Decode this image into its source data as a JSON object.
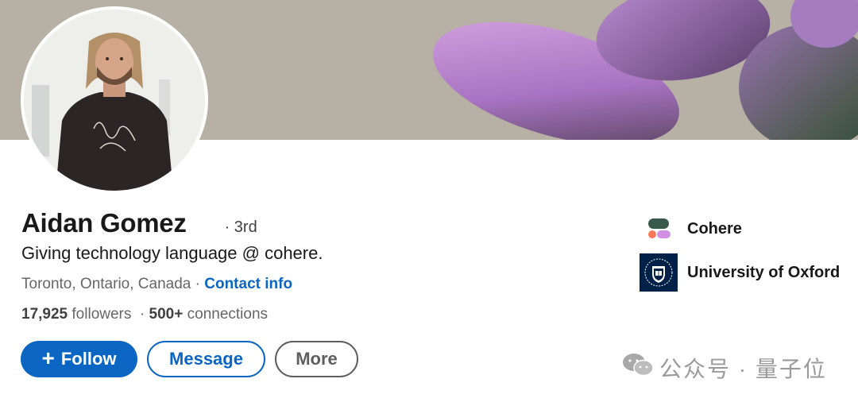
{
  "profile": {
    "name": "Aidan Gomez",
    "degree": "· 3rd",
    "headline": "Giving technology language @ cohere.",
    "location": "Toronto, Ontario, Canada",
    "location_sep": " · ",
    "contact_info": "Contact info",
    "followers_count": "17,925",
    "followers_label": " followers",
    "stats_sep": "  · ",
    "connections_count": "500+",
    "connections_label": " connections"
  },
  "actions": {
    "follow_icon": "+",
    "follow": "Follow",
    "message": "Message",
    "more": "More"
  },
  "organizations": [
    {
      "name": "Cohere",
      "icon": "cohere-logo"
    },
    {
      "name": "University of Oxford",
      "icon": "oxford-crest"
    }
  ],
  "watermark": {
    "text": "公众号 · 量子位",
    "icon": "wechat-icon"
  },
  "colors": {
    "accent": "#0a66c2",
    "banner_bg": "#b7b0a5",
    "banner_shape": "#a779c0",
    "oxford_navy": "#002147"
  }
}
